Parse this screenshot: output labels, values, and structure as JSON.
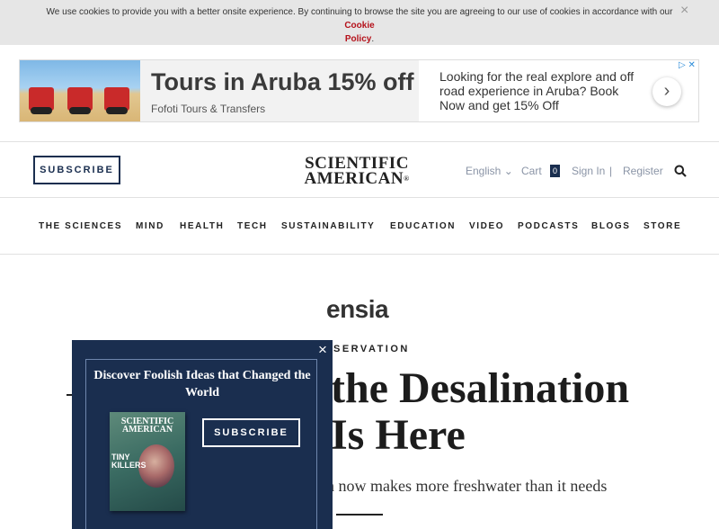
{
  "cookie": {
    "text": "We use cookies to provide you with a better onsite experience. By continuing to browse the site you are agreeing to our use of cookies in accordance with our",
    "link_line1": "Cookie",
    "link_line2": "Policy",
    "period": ".",
    "close_icon": "×"
  },
  "ad": {
    "headline": "Tours in Aruba 15% off",
    "advertiser": "Fofoti Tours & Transfers",
    "description": "Looking for the real explore and off road experience in Aruba? Book Now and get 15% Off",
    "arrow": "›",
    "choices": "▷ ✕"
  },
  "header": {
    "subscribe": "SUBSCRIBE",
    "logo_line1": "SCIENTIFIC",
    "logo_line2": "AMERICAN",
    "logo_mark": "®",
    "language": "English",
    "language_caret": "⌄",
    "cart": "Cart",
    "cart_count": "0",
    "sign_in": "Sign In",
    "separator": "|",
    "register": "Register"
  },
  "nav": {
    "items": [
      "THE SCIENCES",
      "MIND",
      "HEALTH",
      "TECH",
      "SUSTAINABILITY",
      "EDUCATION",
      "VIDEO",
      "PODCASTS",
      "BLOGS",
      "STORE"
    ]
  },
  "article": {
    "partner": "ensia",
    "kicker": "SERVATION",
    "headline_line1": "the Desalination",
    "headline_line2": "Is Here",
    "dek": "h now makes more freshwater than it needs"
  },
  "popup": {
    "title": "Discover Foolish Ideas that Changed the World",
    "subscribe": "SUBSCRIBE",
    "close_icon": "×",
    "magazine": {
      "masthead_line1": "SCIENTIFIC",
      "masthead_line2": "AMERICAN",
      "cover_line1": "TINY",
      "cover_line2": "KILLERS"
    }
  },
  "colors": {
    "brand_navy": "#1a2e4f",
    "cookie_link_red": "#b5121b",
    "cookie_bar_bg": "#e6e6e6"
  }
}
